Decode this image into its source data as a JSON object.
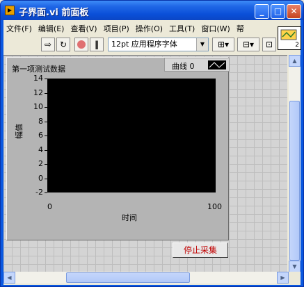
{
  "window": {
    "title": "子界面.vi 前面板",
    "minimize": "_",
    "maximize": "□",
    "close": "✕"
  },
  "menu": [
    "文件(F)",
    "编辑(E)",
    "查看(V)",
    "项目(P)",
    "操作(O)",
    "工具(T)",
    "窗口(W)",
    "帮"
  ],
  "toolbar": {
    "run_icon": "run-arrow-icon",
    "run_continuous_icon": "run-continuous-icon",
    "abort_icon": "abort-icon",
    "pause_icon": "pause-icon",
    "font": "12pt 应用程序字体",
    "align_icon": "align-objects-icon",
    "distribute_icon": "distribute-objects-icon",
    "resize_icon": "resize-objects-icon"
  },
  "vi_icon_number": "2",
  "graph": {
    "label": "第一项测试数据",
    "legend_name": "曲线 0",
    "xlabel": "时间",
    "ylabel": "幅值",
    "xticks": [
      "0",
      "100"
    ],
    "yticks": [
      "14",
      "12",
      "10",
      "8",
      "6",
      "4",
      "2",
      "0",
      "-2"
    ]
  },
  "chart_data": {
    "type": "line",
    "xlabel": "时间",
    "ylabel": "幅值",
    "xlim": [
      0,
      100
    ],
    "ylim": [
      -2,
      14
    ],
    "series": [
      {
        "name": "曲线 0",
        "values": []
      }
    ],
    "grid": false,
    "legend": "top-right"
  },
  "stop_button": "停止采集",
  "colors": {
    "plot_background": "#000000",
    "stop_text": "#c00000",
    "title_bar": "#0a4fd8"
  }
}
